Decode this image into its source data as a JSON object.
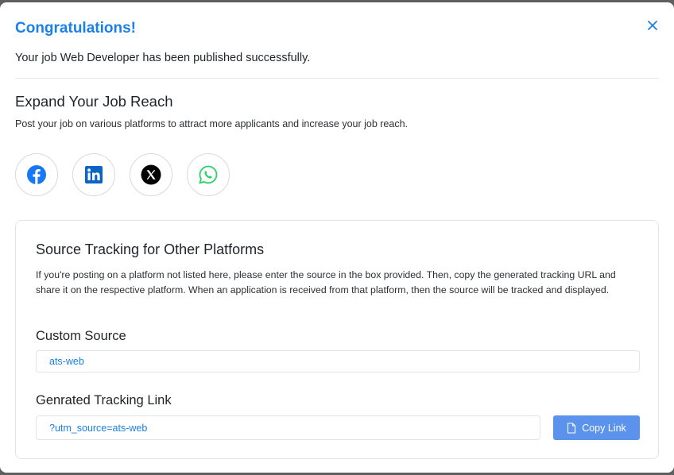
{
  "modal": {
    "title": "Congratulations!",
    "message": "Your job Web Developer has been published successfully.",
    "close_icon": "close-icon"
  },
  "reach": {
    "title": "Expand Your Job Reach",
    "description": "Post your job on various platforms to attract more applicants and increase your job reach.",
    "platforms": [
      {
        "name": "facebook-icon",
        "color": "#1877f2"
      },
      {
        "name": "linkedin-icon",
        "color": "#0a66c2"
      },
      {
        "name": "x-icon",
        "color": "#000000"
      },
      {
        "name": "whatsapp-icon",
        "color": "#25d366"
      }
    ]
  },
  "tracking": {
    "title": "Source Tracking for Other Platforms",
    "description": "If you're posting on a platform not listed here, please enter the source in the box provided. Then, copy the generated tracking URL and share it on the respective platform. When an application is received from that platform, then the source will be tracked and displayed.",
    "custom_source_label": "Custom Source",
    "custom_source_value": "ats-web",
    "link_label": "Genrated Tracking Link",
    "link_value": "?utm_source=ats-web",
    "copy_button_label": "Copy Link",
    "copy_icon": "document-icon"
  },
  "colors": {
    "accent": "#1a7fe8",
    "button": "#5b93ec"
  }
}
